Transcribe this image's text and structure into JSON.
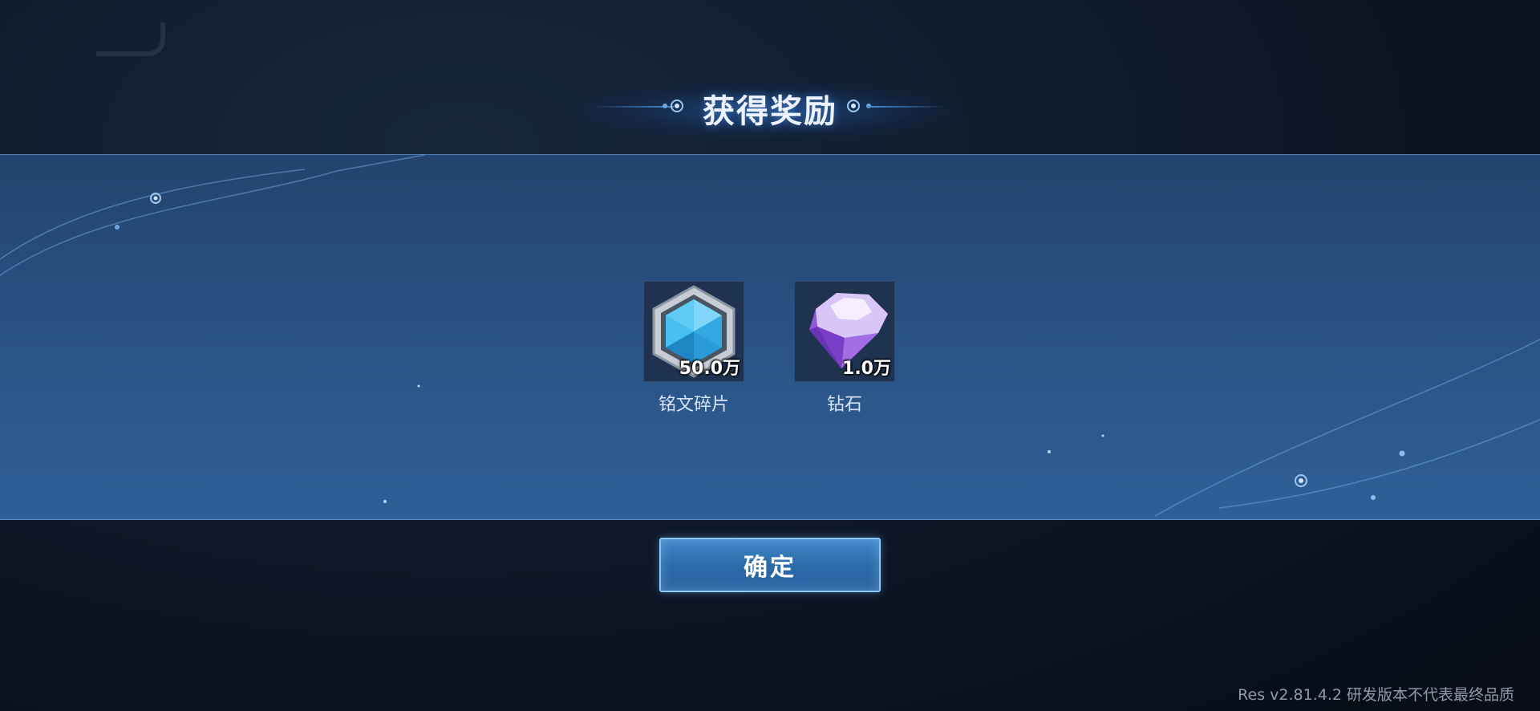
{
  "popup": {
    "title": "获得奖励",
    "confirm_label": "确定"
  },
  "rewards": [
    {
      "name": "铭文碎片",
      "quantity": "50.0万",
      "icon": "inscription-shard-icon"
    },
    {
      "name": "钻石",
      "quantity": "1.0万",
      "icon": "diamond-icon"
    }
  ],
  "version_text": "Res v2.81.4.2 研发版本不代表最终品质",
  "colors": {
    "panel_top": "#22446e",
    "panel_bottom": "#2f5f98",
    "button": "#2c6aa8",
    "button_border": "#8cc6f2"
  }
}
